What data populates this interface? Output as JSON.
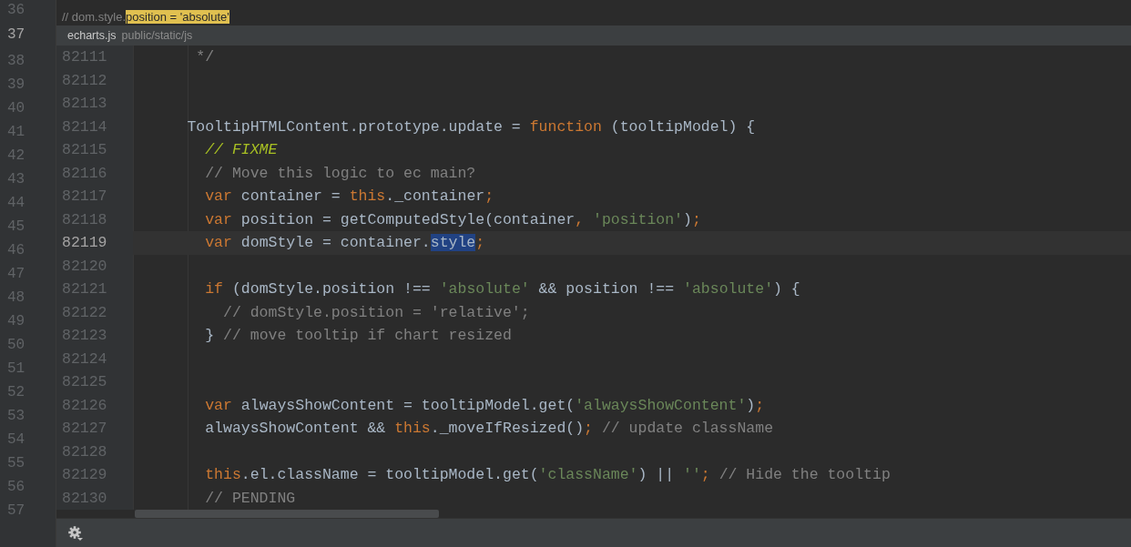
{
  "outer_editor": {
    "line_numbers": [
      {
        "number": "36",
        "current": false
      },
      {
        "number": "37",
        "current": true
      },
      {
        "number": "38",
        "current": false
      },
      {
        "number": "39",
        "current": false
      },
      {
        "number": "40",
        "current": false
      },
      {
        "number": "41",
        "current": false
      },
      {
        "number": "42",
        "current": false
      },
      {
        "number": "43",
        "current": false
      },
      {
        "number": "44",
        "current": false
      },
      {
        "number": "45",
        "current": false
      },
      {
        "number": "46",
        "current": false
      },
      {
        "number": "47",
        "current": false
      },
      {
        "number": "48",
        "current": false
      },
      {
        "number": "49",
        "current": false
      },
      {
        "number": "50",
        "current": false
      },
      {
        "number": "51",
        "current": false
      },
      {
        "number": "52",
        "current": false
      },
      {
        "number": "53",
        "current": false
      },
      {
        "number": "54",
        "current": false
      },
      {
        "number": "55",
        "current": false
      },
      {
        "number": "56",
        "current": false
      },
      {
        "number": "57",
        "current": false
      }
    ],
    "visible_line": [
      {
        "kind": "comment",
        "text": "// dom.style."
      },
      {
        "kind": "match",
        "text": "position = 'absolute'"
      }
    ]
  },
  "popup": {
    "file_name": "echarts.js",
    "file_path": "public/static/js",
    "lines": [
      {
        "number": "82111",
        "current": false,
        "tokens": [
          {
            "kind": "comment",
            "text": "       */"
          }
        ]
      },
      {
        "number": "82112",
        "current": false
      },
      {
        "number": "82113",
        "current": false
      },
      {
        "number": "82114",
        "current": false,
        "tokens": [
          {
            "kind": "plain",
            "text": "      TooltipHTMLContent.prototype.update = "
          },
          {
            "kind": "keyword",
            "text": "function"
          },
          {
            "kind": "plain",
            "text": " (tooltipModel) {"
          }
        ]
      },
      {
        "number": "82115",
        "current": false,
        "tokens": [
          {
            "kind": "todo",
            "text": "        // FIXME"
          }
        ]
      },
      {
        "number": "82116",
        "current": false,
        "tokens": [
          {
            "kind": "comment",
            "text": "        // Move this logic to ec main?"
          }
        ]
      },
      {
        "number": "82117",
        "current": false,
        "tokens": [
          {
            "kind": "keyword",
            "text": "        var"
          },
          {
            "kind": "plain",
            "text": " container = "
          },
          {
            "kind": "keyword",
            "text": "this"
          },
          {
            "kind": "plain",
            "text": "._container"
          },
          {
            "kind": "keyword",
            "text": ";"
          }
        ]
      },
      {
        "number": "82118",
        "current": false,
        "tokens": [
          {
            "kind": "keyword",
            "text": "        var"
          },
          {
            "kind": "plain",
            "text": " position = getComputedStyle(container"
          },
          {
            "kind": "keyword",
            "text": ","
          },
          {
            "kind": "string",
            "text": " 'position'"
          },
          {
            "kind": "plain",
            "text": ")"
          },
          {
            "kind": "keyword",
            "text": ";"
          }
        ]
      },
      {
        "number": "82119",
        "current": true,
        "tokens": [
          {
            "kind": "keyword",
            "text": "        var"
          },
          {
            "kind": "plain",
            "text": " domStyle = container."
          },
          {
            "kind": "selected",
            "text": "style"
          },
          {
            "kind": "keyword",
            "text": ";"
          }
        ]
      },
      {
        "number": "82120",
        "current": false
      },
      {
        "number": "82121",
        "current": false,
        "tokens": [
          {
            "kind": "keyword",
            "text": "        if"
          },
          {
            "kind": "plain",
            "text": " (domStyle.position !== "
          },
          {
            "kind": "string",
            "text": "'absolute'"
          },
          {
            "kind": "plain",
            "text": " && position !== "
          },
          {
            "kind": "string",
            "text": "'absolute'"
          },
          {
            "kind": "plain",
            "text": ") {"
          }
        ]
      },
      {
        "number": "82122",
        "current": false,
        "tokens": [
          {
            "kind": "comment",
            "text": "          // domStyle.position = 'relative';"
          }
        ]
      },
      {
        "number": "82123",
        "current": false,
        "tokens": [
          {
            "kind": "plain",
            "text": "        } "
          },
          {
            "kind": "comment",
            "text": "// move tooltip if chart resized"
          }
        ]
      },
      {
        "number": "82124",
        "current": false
      },
      {
        "number": "82125",
        "current": false
      },
      {
        "number": "82126",
        "current": false,
        "tokens": [
          {
            "kind": "keyword",
            "text": "        var"
          },
          {
            "kind": "plain",
            "text": " alwaysShowContent = tooltipModel.get("
          },
          {
            "kind": "string",
            "text": "'alwaysShowContent'"
          },
          {
            "kind": "plain",
            "text": ")"
          },
          {
            "kind": "keyword",
            "text": ";"
          }
        ]
      },
      {
        "number": "82127",
        "current": false,
        "tokens": [
          {
            "kind": "plain",
            "text": "        alwaysShowContent && "
          },
          {
            "kind": "keyword",
            "text": "this"
          },
          {
            "kind": "plain",
            "text": "._moveIfResized()"
          },
          {
            "kind": "keyword",
            "text": ";"
          },
          {
            "kind": "comment",
            "text": " // update className"
          }
        ]
      },
      {
        "number": "82128",
        "current": false
      },
      {
        "number": "82129",
        "current": false,
        "tokens": [
          {
            "kind": "keyword",
            "text": "        this"
          },
          {
            "kind": "plain",
            "text": ".el.className = tooltipModel.get("
          },
          {
            "kind": "string",
            "text": "'className'"
          },
          {
            "kind": "plain",
            "text": ") || "
          },
          {
            "kind": "string",
            "text": "''"
          },
          {
            "kind": "keyword",
            "text": ";"
          },
          {
            "kind": "comment",
            "text": " // Hide the tooltip"
          }
        ]
      },
      {
        "number": "82130",
        "current": false,
        "tokens": [
          {
            "kind": "comment",
            "text": "        // PENDING"
          }
        ]
      }
    ]
  }
}
